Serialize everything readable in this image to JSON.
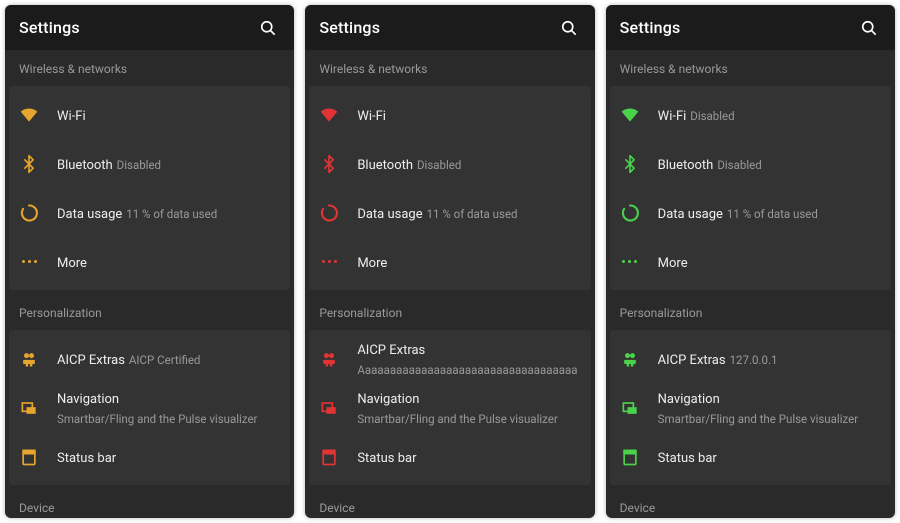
{
  "panels": [
    {
      "accent": "#E6A62E",
      "appbar_title": "Settings",
      "section_wireless": "Wireless & networks",
      "section_personalization": "Personalization",
      "section_device": "Device",
      "wifi": {
        "label": "Wi-Fi",
        "status": ""
      },
      "bluetooth": {
        "label": "Bluetooth",
        "status": "Disabled"
      },
      "data_usage": {
        "label": "Data usage",
        "status": "11 % of data used"
      },
      "more": {
        "label": "More"
      },
      "aicp": {
        "label": "AICP Extras",
        "status": "AICP Certified"
      },
      "navigation": {
        "label": "Navigation",
        "status": "Smartbar/Fling and the Pulse visualizer"
      },
      "statusbar": {
        "label": "Status bar"
      }
    },
    {
      "accent": "#E23434",
      "appbar_title": "Settings",
      "section_wireless": "Wireless & networks",
      "section_personalization": "Personalization",
      "section_device": "Device",
      "wifi": {
        "label": "Wi-Fi",
        "status": ""
      },
      "bluetooth": {
        "label": "Bluetooth",
        "status": "Disabled"
      },
      "data_usage": {
        "label": "Data usage",
        "status": "11 % of data used"
      },
      "more": {
        "label": "More"
      },
      "aicp": {
        "label": "AICP Extras",
        "status": "Aaaaaaaaaaaaaaaaaaaaaaaaaaaaaaaaaaaaaaaa..."
      },
      "navigation": {
        "label": "Navigation",
        "status": "Smartbar/Fling and the Pulse visualizer"
      },
      "statusbar": {
        "label": "Status bar"
      }
    },
    {
      "accent": "#4BD24B",
      "appbar_title": "Settings",
      "section_wireless": "Wireless & networks",
      "section_personalization": "Personalization",
      "section_device": "Device",
      "wifi": {
        "label": "Wi-Fi",
        "status": "Disabled"
      },
      "bluetooth": {
        "label": "Bluetooth",
        "status": "Disabled"
      },
      "data_usage": {
        "label": "Data usage",
        "status": "11 % of data used"
      },
      "more": {
        "label": "More"
      },
      "aicp": {
        "label": "AICP Extras",
        "status": "127.0.0.1"
      },
      "navigation": {
        "label": "Navigation",
        "status": "Smartbar/Fling and the Pulse visualizer"
      },
      "statusbar": {
        "label": "Status bar"
      }
    }
  ]
}
